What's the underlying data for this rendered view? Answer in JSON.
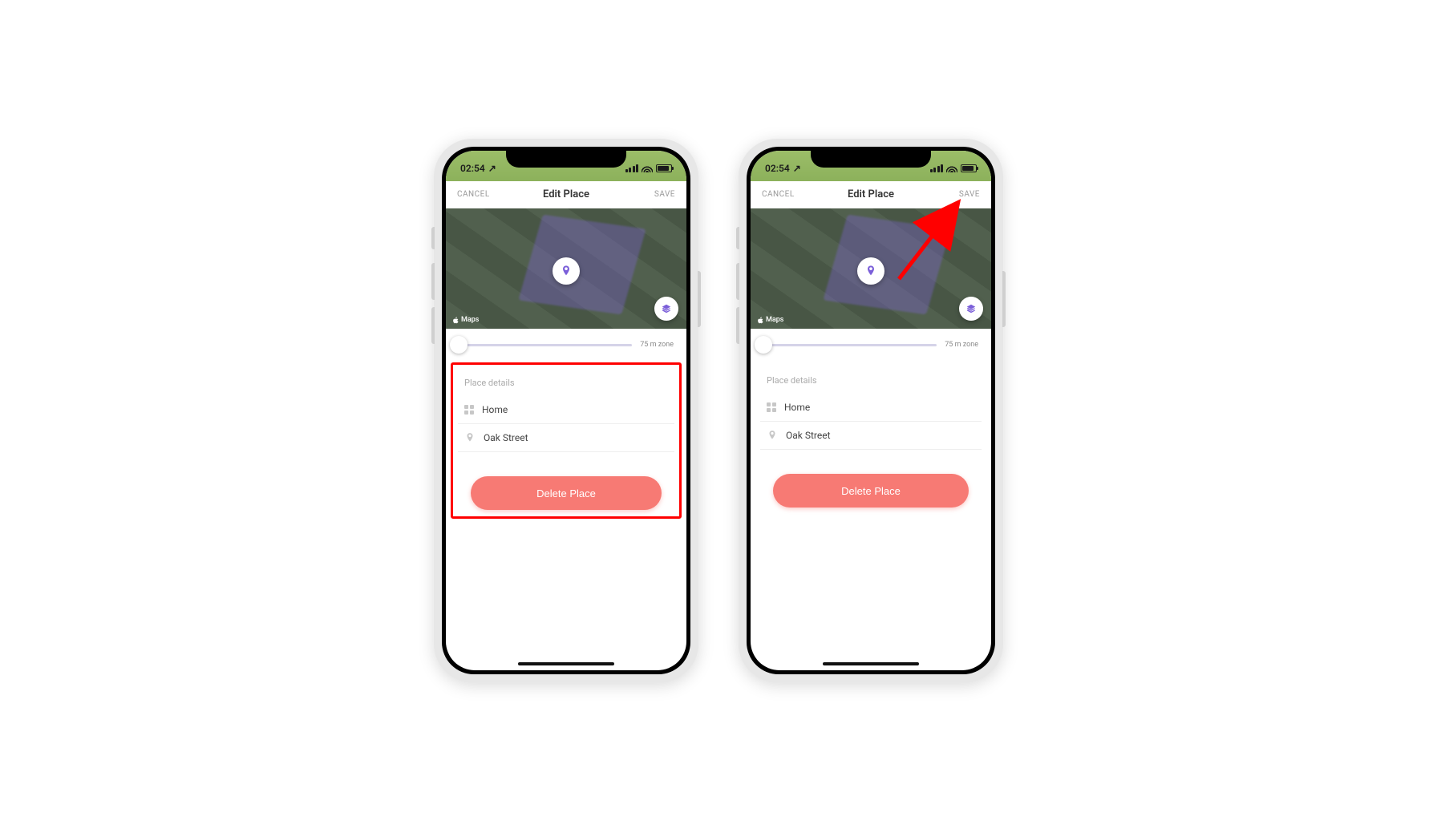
{
  "status": {
    "time": "02:54",
    "location_arrow": "↗"
  },
  "nav": {
    "cancel": "CANCEL",
    "title": "Edit Place",
    "save": "SAVE"
  },
  "map": {
    "attribution": "Maps"
  },
  "slider": {
    "zone_label": "75 m zone"
  },
  "details": {
    "section_label": "Place details",
    "name_value": "Home",
    "address_value": "Oak Street"
  },
  "actions": {
    "delete_label": "Delete Place"
  },
  "colors": {
    "accent_purple": "#7b5fd9",
    "danger": "#f77a74",
    "highlight": "#ff0000"
  }
}
